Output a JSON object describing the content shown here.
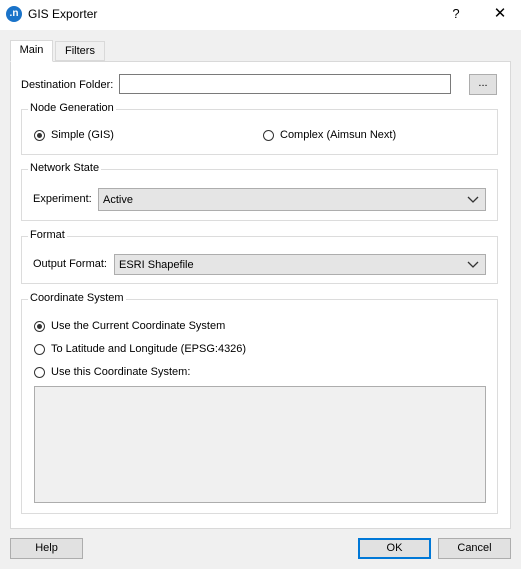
{
  "window": {
    "app_icon_glyph": ".n",
    "title": "GIS Exporter",
    "help_glyph": "?",
    "close_glyph": "✕"
  },
  "tabs": [
    {
      "label": "Main",
      "active": true
    },
    {
      "label": "Filters",
      "active": false
    }
  ],
  "destination": {
    "label": "Destination Folder:",
    "value": "",
    "browse_label": "..."
  },
  "node_generation": {
    "title": "Node Generation",
    "options": [
      {
        "label": "Simple (GIS)",
        "checked": true
      },
      {
        "label": "Complex (Aimsun Next)",
        "checked": false
      }
    ]
  },
  "network_state": {
    "title": "Network State",
    "experiment_label": "Experiment:",
    "experiment_value": "Active"
  },
  "format": {
    "title": "Format",
    "output_label": "Output Format:",
    "output_value": "ESRI Shapefile"
  },
  "coordinate_system": {
    "title": "Coordinate System",
    "options": [
      {
        "label": "Use the Current Coordinate System",
        "checked": true
      },
      {
        "label": "To Latitude and Longitude (EPSG:4326)",
        "checked": false
      },
      {
        "label": "Use this Coordinate System:",
        "checked": false
      }
    ],
    "custom_text": ""
  },
  "buttons": {
    "help": "Help",
    "ok": "OK",
    "cancel": "Cancel"
  }
}
